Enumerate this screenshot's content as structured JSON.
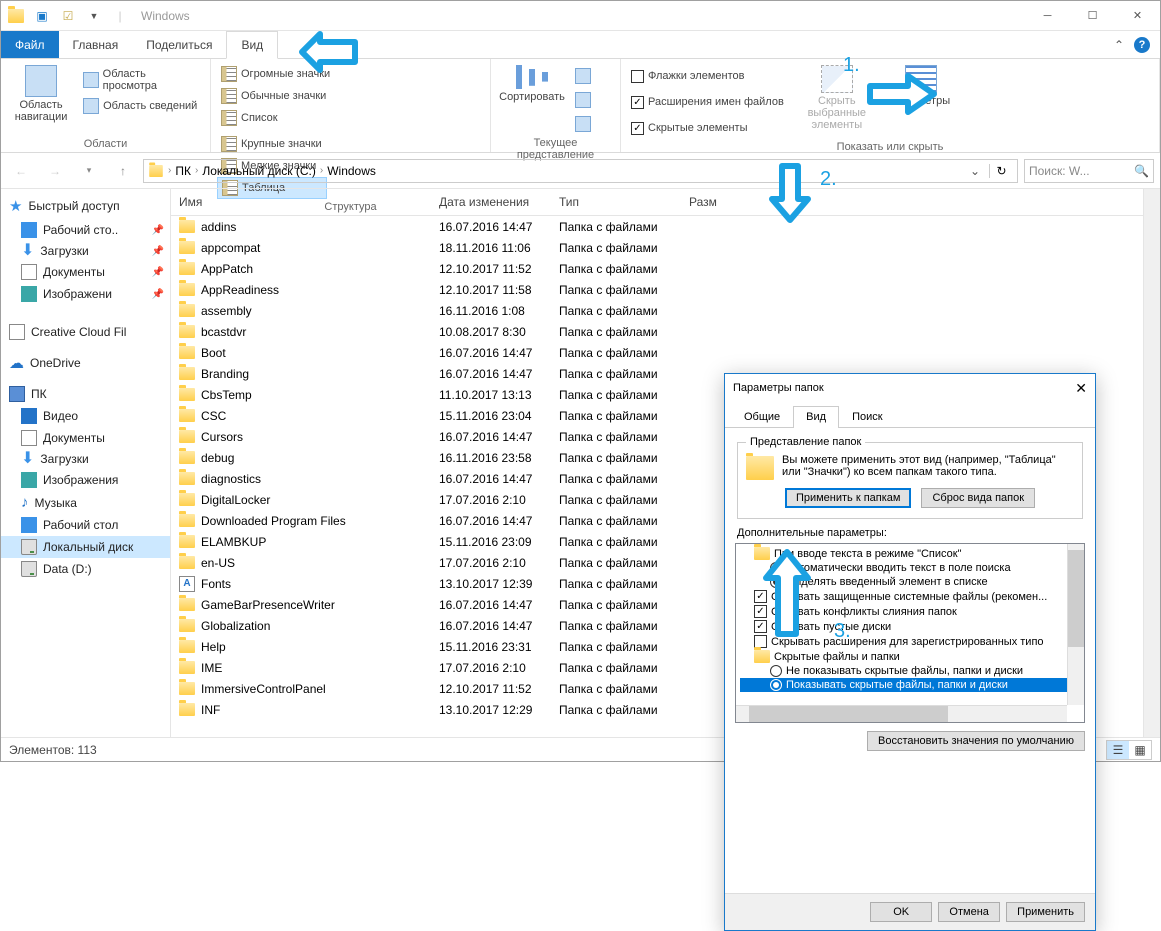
{
  "titlebar": {
    "title": "Windows"
  },
  "menu": {
    "file": "Файл",
    "home": "Главная",
    "share": "Поделиться",
    "view": "Вид"
  },
  "ribbon": {
    "panes": {
      "navigation": "Область навигации",
      "preview": "Область просмотра",
      "details": "Область сведений",
      "group": "Области"
    },
    "layout": {
      "huge": "Огромные значки",
      "large": "Крупные значки",
      "medium": "Обычные значки",
      "small": "Мелкие значки",
      "list": "Список",
      "table": "Таблица",
      "group": "Структура"
    },
    "current": {
      "sort": "Сортировать",
      "group": "Текущее представление"
    },
    "showhide": {
      "checkboxes": "Флажки элементов",
      "extensions": "Расширения имен файлов",
      "hidden": "Скрытые элементы",
      "hidesel": "Скрыть выбранные элементы",
      "params": "Параметры",
      "group": "Показать или скрыть"
    }
  },
  "breadcrumb": {
    "items": [
      "ПК",
      "Локальный диск (C:)",
      "Windows"
    ]
  },
  "search": {
    "placeholder": "Поиск: W..."
  },
  "sidebar": {
    "quick": "Быстрый доступ",
    "desktop": "Рабочий сто..",
    "downloads": "Загрузки",
    "documents": "Документы",
    "pictures": "Изображени",
    "ccf": "Creative Cloud Fil",
    "onedrive": "OneDrive",
    "pc": "ПК",
    "video": "Видео",
    "docs2": "Документы",
    "dl2": "Загрузки",
    "pics2": "Изображения",
    "music": "Музыка",
    "desk2": "Рабочий стол",
    "cdrive": "Локальный диск",
    "ddrive": "Data (D:)"
  },
  "columns": {
    "name": "Имя",
    "date": "Дата изменения",
    "type": "Тип",
    "size": "Разм"
  },
  "files": [
    {
      "name": "addins",
      "date": "16.07.2016 14:47",
      "type": "Папка с файлами",
      "icon": "folder"
    },
    {
      "name": "appcompat",
      "date": "18.11.2016 11:06",
      "type": "Папка с файлами",
      "icon": "folder"
    },
    {
      "name": "AppPatch",
      "date": "12.10.2017 11:52",
      "type": "Папка с файлами",
      "icon": "folder"
    },
    {
      "name": "AppReadiness",
      "date": "12.10.2017 11:58",
      "type": "Папка с файлами",
      "icon": "folder"
    },
    {
      "name": "assembly",
      "date": "16.11.2016 1:08",
      "type": "Папка с файлами",
      "icon": "folder"
    },
    {
      "name": "bcastdvr",
      "date": "10.08.2017 8:30",
      "type": "Папка с файлами",
      "icon": "folder"
    },
    {
      "name": "Boot",
      "date": "16.07.2016 14:47",
      "type": "Папка с файлами",
      "icon": "folder"
    },
    {
      "name": "Branding",
      "date": "16.07.2016 14:47",
      "type": "Папка с файлами",
      "icon": "folder"
    },
    {
      "name": "CbsTemp",
      "date": "11.10.2017 13:13",
      "type": "Папка с файлами",
      "icon": "folder"
    },
    {
      "name": "CSC",
      "date": "15.11.2016 23:04",
      "type": "Папка с файлами",
      "icon": "folder"
    },
    {
      "name": "Cursors",
      "date": "16.07.2016 14:47",
      "type": "Папка с файлами",
      "icon": "folder"
    },
    {
      "name": "debug",
      "date": "16.11.2016 23:58",
      "type": "Папка с файлами",
      "icon": "folder"
    },
    {
      "name": "diagnostics",
      "date": "16.07.2016 14:47",
      "type": "Папка с файлами",
      "icon": "folder"
    },
    {
      "name": "DigitalLocker",
      "date": "17.07.2016 2:10",
      "type": "Папка с файлами",
      "icon": "folder"
    },
    {
      "name": "Downloaded Program Files",
      "date": "16.07.2016 14:47",
      "type": "Папка с файлами",
      "icon": "folder"
    },
    {
      "name": "ELAMBKUP",
      "date": "15.11.2016 23:09",
      "type": "Папка с файлами",
      "icon": "folder"
    },
    {
      "name": "en-US",
      "date": "17.07.2016 2:10",
      "type": "Папка с файлами",
      "icon": "folder"
    },
    {
      "name": "Fonts",
      "date": "13.10.2017 12:39",
      "type": "Папка с файлами",
      "icon": "font"
    },
    {
      "name": "GameBarPresenceWriter",
      "date": "16.07.2016 14:47",
      "type": "Папка с файлами",
      "icon": "folder"
    },
    {
      "name": "Globalization",
      "date": "16.07.2016 14:47",
      "type": "Папка с файлами",
      "icon": "folder"
    },
    {
      "name": "Help",
      "date": "15.11.2016 23:31",
      "type": "Папка с файлами",
      "icon": "folder"
    },
    {
      "name": "IME",
      "date": "17.07.2016 2:10",
      "type": "Папка с файлами",
      "icon": "folder"
    },
    {
      "name": "ImmersiveControlPanel",
      "date": "12.10.2017 11:52",
      "type": "Папка с файлами",
      "icon": "folder"
    },
    {
      "name": "INF",
      "date": "13.10.2017 12:29",
      "type": "Папка с файлами",
      "icon": "folder"
    }
  ],
  "status": {
    "count": "Элементов: 113"
  },
  "dialog": {
    "title": "Параметры папок",
    "tabs": {
      "general": "Общие",
      "view": "Вид",
      "search": "Поиск"
    },
    "folder_views": {
      "legend": "Представление папок",
      "text": "Вы можете применить этот вид (например, \"Таблица\" или \"Значки\") ко всем папкам такого типа.",
      "apply": "Применить к папкам",
      "reset": "Сброс вида папок"
    },
    "advanced": {
      "label": "Дополнительные параметры:",
      "items": [
        {
          "type": "folder",
          "lvl": 1,
          "text": "При вводе текста в режиме \"Список\""
        },
        {
          "type": "radio",
          "lvl": 2,
          "on": false,
          "text": "Автоматически вводить текст в поле поиска"
        },
        {
          "type": "radio",
          "lvl": 2,
          "on": true,
          "text": "Выделять введенный элемент в списке"
        },
        {
          "type": "check",
          "lvl": 1,
          "on": true,
          "text": "Скрывать защищенные системные файлы (рекомен..."
        },
        {
          "type": "check",
          "lvl": 1,
          "on": true,
          "text": "Скрывать конфликты слияния папок"
        },
        {
          "type": "check",
          "lvl": 1,
          "on": true,
          "text": "Скрывать пустые диски"
        },
        {
          "type": "check",
          "lvl": 1,
          "on": false,
          "text": "Скрывать расширения для зарегистрированных типо"
        },
        {
          "type": "folder",
          "lvl": 1,
          "text": "Скрытые файлы и папки"
        },
        {
          "type": "radio",
          "lvl": 2,
          "on": false,
          "text": "Не показывать скрытые файлы, папки и диски"
        },
        {
          "type": "radio",
          "lvl": 2,
          "on": true,
          "selected": true,
          "text": "Показывать скрытые файлы, папки и диски"
        }
      ],
      "restore": "Восстановить значения по умолчанию"
    },
    "buttons": {
      "ok": "OK",
      "cancel": "Отмена",
      "apply": "Применить"
    }
  },
  "annotations": {
    "n1": "1.",
    "n2": "2.",
    "n3": "3."
  }
}
